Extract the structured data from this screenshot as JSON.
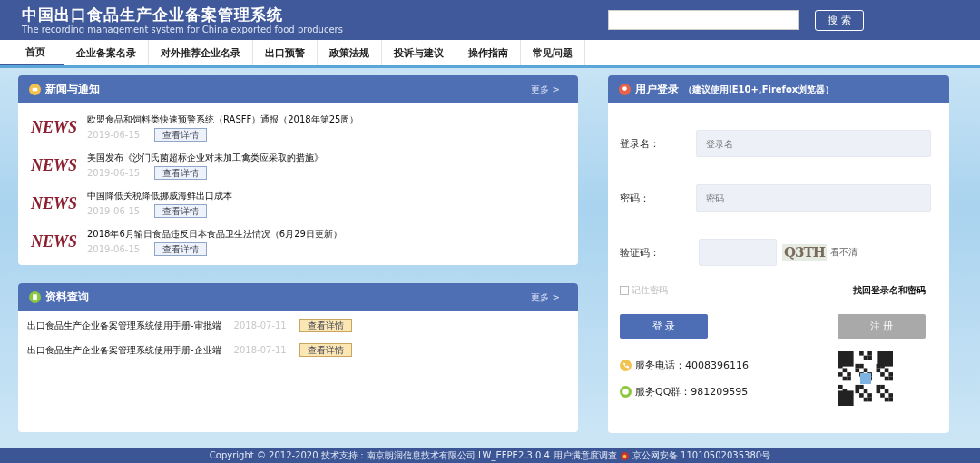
{
  "header": {
    "title": "中国出口食品生产企业备案管理系统",
    "subtitle": "The recording management system for China exported food producers",
    "search_button": "搜 索"
  },
  "nav": [
    {
      "label": "首页",
      "selected": true
    },
    {
      "label": "企业备案名录",
      "selected": false
    },
    {
      "label": "对外推荐企业名录",
      "selected": false
    },
    {
      "label": "出口预警",
      "selected": false
    },
    {
      "label": "政策法规",
      "selected": false
    },
    {
      "label": "投诉与建议",
      "selected": false
    },
    {
      "label": "操作指南",
      "selected": false
    },
    {
      "label": "常见问题",
      "selected": false
    }
  ],
  "news": {
    "title": "新闻与通知",
    "more": "更多 >",
    "items": [
      {
        "badge": "NEWS",
        "title": "欧盟食品和饲料类快速预警系统（RASFF）通报（2018年第25周）",
        "date": "2019-06-15",
        "button": "查看详情"
      },
      {
        "badge": "NEWS",
        "title": "美国发布《沙门氏菌超标企业对未加工禽类应采取的措施》",
        "date": "2019-06-15",
        "button": "查看详情"
      },
      {
        "badge": "NEWS",
        "title": "中国降低关税降低挪威海鲜出口成本",
        "date": "2019-06-15",
        "button": "查看详情"
      },
      {
        "badge": "NEWS",
        "title": "2018年6月输日食品违反日本食品卫生法情况（6月29日更新）",
        "date": "2019-06-15",
        "button": "查看详情"
      }
    ]
  },
  "documents": {
    "title": "资料查询",
    "more": "更多 >",
    "items": [
      {
        "title": "出口食品生产企业备案管理系统使用手册-审批端",
        "date": "2018-07-11",
        "button": "查看详情"
      },
      {
        "title": "出口食品生产企业备案管理系统使用手册-企业端",
        "date": "2018-07-11",
        "button": "查看详情"
      }
    ]
  },
  "login": {
    "title": "用户登录",
    "hint": "（建议使用IE10+,Firefox浏览器）",
    "username_label": "登录名：",
    "username_placeholder": "登录名",
    "password_label": "密码：",
    "password_placeholder": "密码",
    "captcha_label": "验证码：",
    "captcha_image": "Q3TH",
    "captcha_refresh": "看不清",
    "remember": {
      "label": "记住密码",
      "checked": false
    },
    "recover": "找回登录名和密码",
    "login_button": "登 录",
    "register_button": "注 册",
    "phone": "服务电话：4008396116",
    "qq": "服务QQ群：981209595"
  },
  "footer": {
    "text": "Copyright © 2012-2020 技术支持：南京朗润信息技术有限公司 LW_EFPE2.3.0.4",
    "survey": "用户满意度调查",
    "record": "京公网安备 11010502035380号"
  }
}
